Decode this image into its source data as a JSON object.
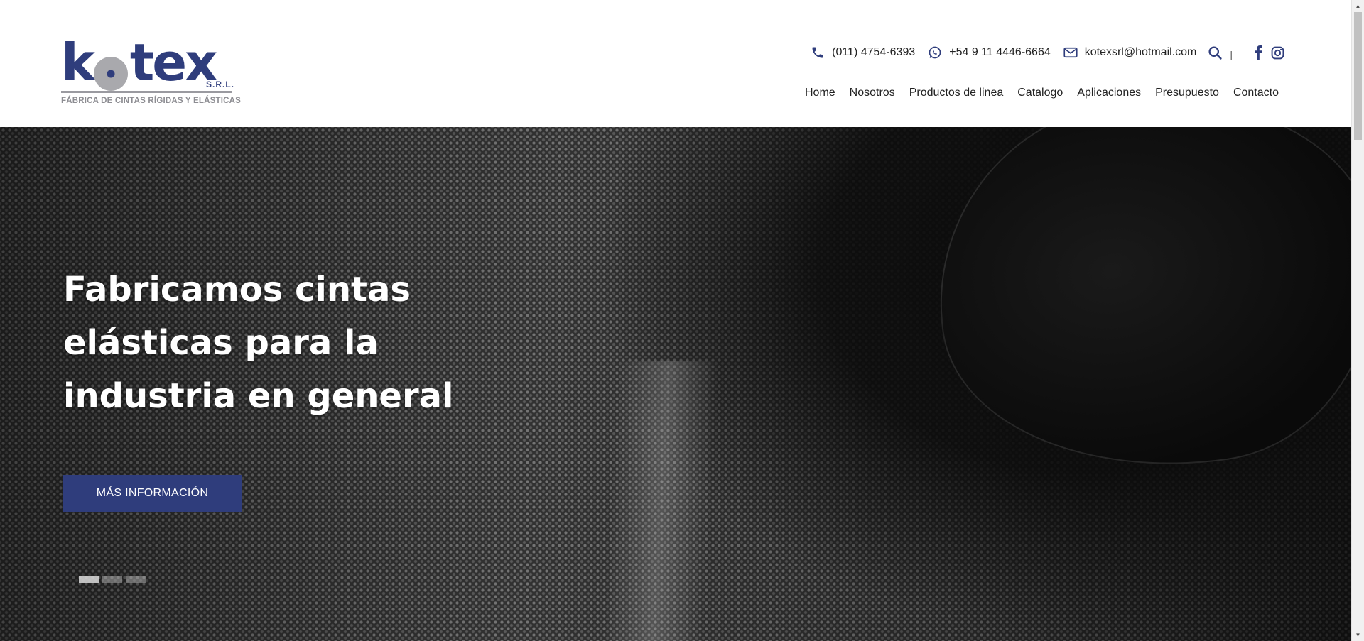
{
  "brand": {
    "logo_word": "k tex",
    "logo_k": "k",
    "logo_tex": "tex",
    "suffix": "S.R.L.",
    "tagline": "FÁBRICA DE CINTAS RÍGIDAS Y ELÁSTICAS",
    "primary_color": "#2f3d7c"
  },
  "contact": {
    "phone": "(011) 4754-6393",
    "whatsapp": "+54 9 11 4446-6664",
    "email": "kotexsrl@hotmail.com",
    "separator": "|"
  },
  "icons": {
    "phone": "phone-icon",
    "whatsapp": "whatsapp-icon",
    "email": "envelope-icon",
    "search": "search-icon",
    "facebook": "facebook-icon",
    "instagram": "instagram-icon"
  },
  "nav": {
    "items": [
      "Home",
      "Nosotros",
      "Productos de linea",
      "Catalogo",
      "Aplicaciones",
      "Presupuesto",
      "Contacto"
    ]
  },
  "hero": {
    "title": "Fabricamos cintas elásticas para la industria en general",
    "button_label": "MÁS INFORMACIÓN",
    "slides_total": 3,
    "active_slide": 1
  }
}
